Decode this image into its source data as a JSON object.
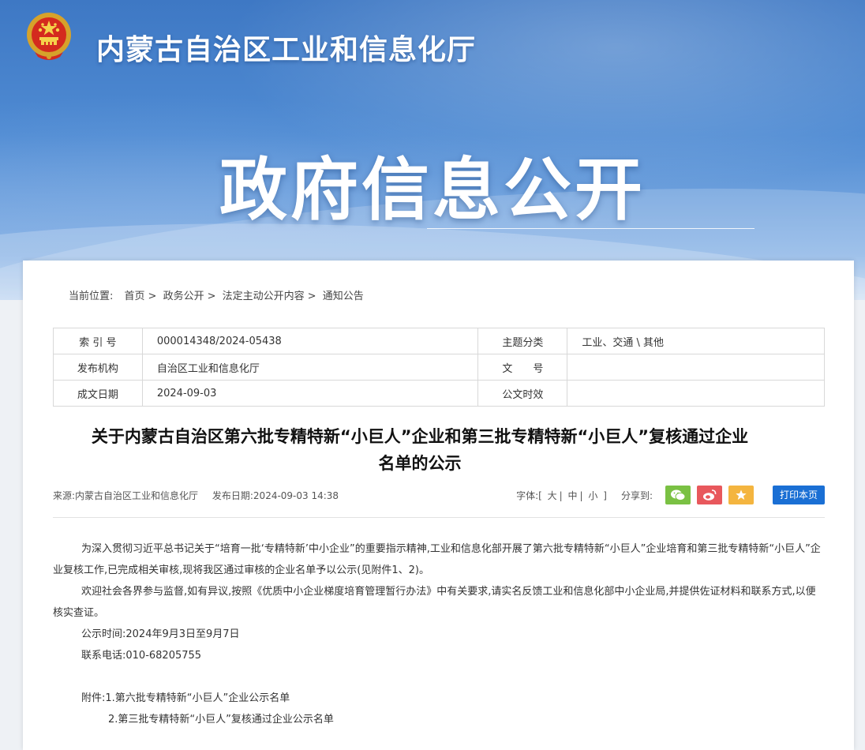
{
  "header": {
    "site_title": "内蒙古自治区工业和信息化厅",
    "banner_title": "政府信息公开"
  },
  "breadcrumb": {
    "label": "当前位置:",
    "items": [
      "首页",
      "政务公开",
      "法定主动公开内容",
      "通知公告"
    ],
    "separator": ">"
  },
  "meta_table": {
    "index_label": "索 引 号",
    "index_value": "000014348/2024-05438",
    "topic_label": "主题分类",
    "topic_value": "工业、交通 \\ 其他",
    "issuer_label": "发布机构",
    "issuer_value": "自治区工业和信息化厅",
    "docno_label": "文　　号",
    "docno_value": "",
    "date_label": "成文日期",
    "date_value": "2024-09-03",
    "validity_label": "公文时效",
    "validity_value": ""
  },
  "article": {
    "title_line1": "关于内蒙古自治区第六批专精特新“小巨人”企业和第三批专精特新“小巨人”复核通过企业",
    "title_line2": "名单的公示",
    "source": "来源:内蒙古自治区工业和信息化厅",
    "publish_date": "发布日期:2024-09-03 14:38",
    "font_label": "字体:",
    "font_open": "[",
    "font_large": "大",
    "font_medium": "中",
    "font_small": "小",
    "font_close": "]",
    "font_sep": "|",
    "share_label": "分享到:",
    "print_label": "打印本页",
    "paragraph1": "为深入贯彻习近平总书记关于“培育一批‘专精特新’中小企业”的重要指示精神,工业和信息化部开展了第六批专精特新“小巨人”企业培育和第三批专精特新“小巨人”企业复核工作,已完成相关审核,现将我区通过审核的企业名单予以公示(见附件1、2)。",
    "paragraph2": "欢迎社会各界参与监督,如有异议,按照《优质中小企业梯度培育管理暂行办法》中有关要求,请实名反馈工业和信息化部中小企业局,并提供佐证材料和联系方式,以便核实查证。",
    "period": "公示时间:2024年9月3日至9月7日",
    "phone": "联系电话:010-68205755",
    "attachment1": "附件:1.第六批专精特新“小巨人”企业公示名单",
    "attachment2": "2.第三批专精特新“小巨人”复核通过企业公示名单"
  },
  "colors": {
    "banner_blue": "#3e78c4",
    "print_button": "#1a6fd4",
    "wechat": "#7ac143",
    "weibo": "#e8585c",
    "favorite": "#f4b53f"
  },
  "icons": [
    "national-emblem-icon",
    "wechat-icon",
    "weibo-icon",
    "star-icon"
  ]
}
